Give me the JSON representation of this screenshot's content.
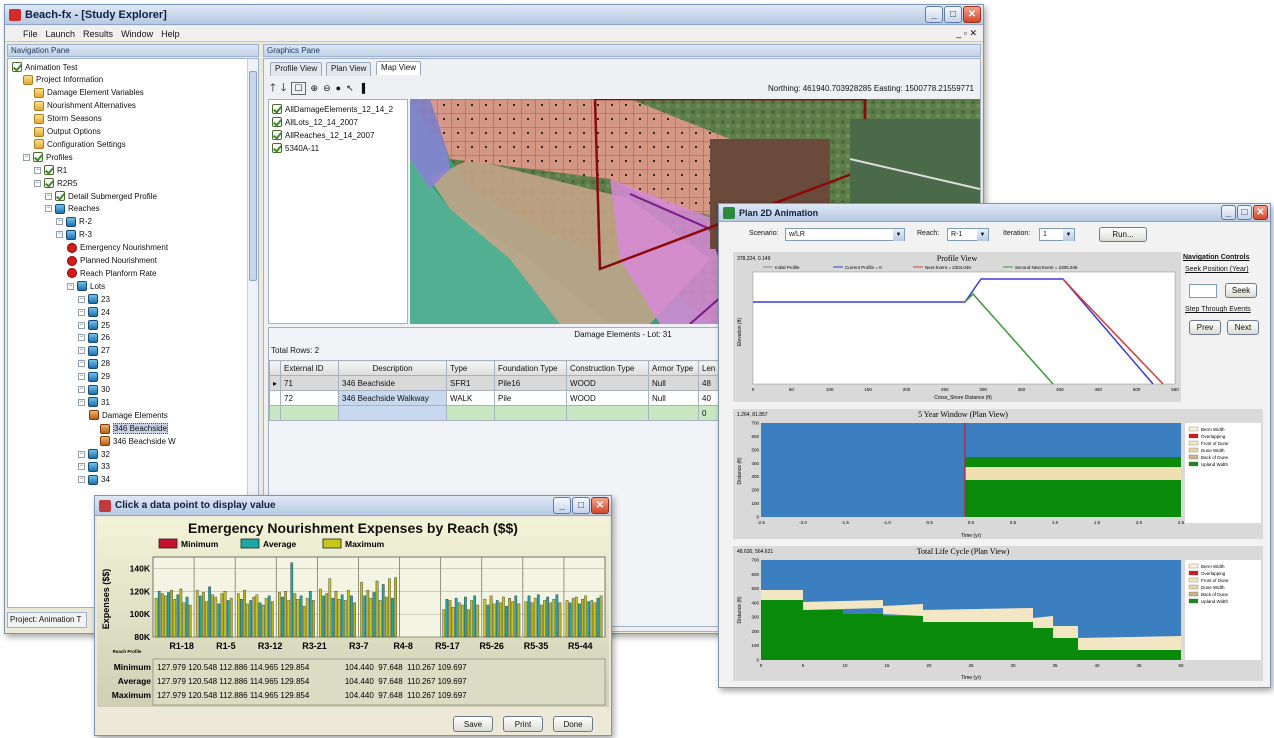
{
  "main_window": {
    "title": "Beach-fx - [Study Explorer]",
    "menu": [
      "File",
      "Launch",
      "Results",
      "Window",
      "Help"
    ],
    "nav_pane_title": "Navigation Pane",
    "graphics_pane_title": "Graphics Pane",
    "status": "Project: Animation T",
    "tree": [
      {
        "label": "Animation Test",
        "icon": "checkbox-icon",
        "level": 0
      },
      {
        "label": "Project Information",
        "icon": "folder-icon",
        "level": 1
      },
      {
        "label": "Damage Element Variables",
        "icon": "folder-icon",
        "level": 2
      },
      {
        "label": "Nourishment Alternatives",
        "icon": "folder-icon",
        "level": 2
      },
      {
        "label": "Storm Seasons",
        "icon": "folder-icon",
        "level": 2
      },
      {
        "label": "Output Options",
        "icon": "folder-icon",
        "level": 2
      },
      {
        "label": "Configuration Settings",
        "icon": "folder-icon",
        "level": 2
      },
      {
        "label": "Profiles",
        "icon": "checkbox-icon",
        "level": 1
      },
      {
        "label": "R1",
        "icon": "checkbox-icon",
        "level": 2
      },
      {
        "label": "R2R5",
        "icon": "checkbox-icon",
        "level": 2
      },
      {
        "label": "Detail Submerged Profile",
        "icon": "checkbox-icon",
        "level": 3
      },
      {
        "label": "Reaches",
        "icon": "lot-icon",
        "level": 3
      },
      {
        "label": "R-2",
        "icon": "lot-icon",
        "level": 4
      },
      {
        "label": "R-3",
        "icon": "lot-icon",
        "level": 4
      },
      {
        "label": "Emergency Nourishment",
        "icon": "red-icon",
        "level": 5
      },
      {
        "label": "Planned Nourishment",
        "icon": "red-icon",
        "level": 5
      },
      {
        "label": "Reach Planform Rate",
        "icon": "red-icon",
        "level": 5
      },
      {
        "label": "Lots",
        "icon": "lot-icon",
        "level": 5
      },
      {
        "label": "23",
        "icon": "lot-icon",
        "level": 6
      },
      {
        "label": "24",
        "icon": "lot-icon",
        "level": 6
      },
      {
        "label": "25",
        "icon": "lot-icon",
        "level": 6
      },
      {
        "label": "26",
        "icon": "lot-icon",
        "level": 6
      },
      {
        "label": "27",
        "icon": "lot-icon",
        "level": 6
      },
      {
        "label": "28",
        "icon": "lot-icon",
        "level": 6
      },
      {
        "label": "29",
        "icon": "lot-icon",
        "level": 6
      },
      {
        "label": "30",
        "icon": "lot-icon",
        "level": 6
      },
      {
        "label": "31",
        "icon": "lot-icon",
        "level": 6
      },
      {
        "label": "Damage Elements",
        "icon": "damage-icon",
        "level": 7
      },
      {
        "label": "346 Beachside",
        "icon": "damage-icon",
        "level": 8,
        "selected": true
      },
      {
        "label": "346 Beachside W",
        "icon": "damage-icon",
        "level": 8
      },
      {
        "label": "32",
        "icon": "lot-icon",
        "level": 6
      },
      {
        "label": "33",
        "icon": "lot-icon",
        "level": 6
      },
      {
        "label": "34",
        "icon": "lot-icon",
        "level": 6
      }
    ],
    "tabs": [
      "Profile View",
      "Plan View",
      "Map View"
    ],
    "active_tab": "Map View",
    "coords": "Northing: 461940.703928285  Easting: 1500778.21559771",
    "layers": [
      "AllDamageElements_12_14_2",
      "AllLots_12_14_2007",
      "AllReaches_12_14_2007",
      "5340A-11"
    ],
    "grid_title": "Damage Elements -  Lot: 31",
    "total_rows": "Total Rows: 2",
    "grid_columns": [
      "External ID",
      "Description",
      "Type",
      "Foundation Type",
      "Construction Type",
      "Armor Type",
      "Len"
    ],
    "grid_rows": [
      [
        "71",
        "346 Beachside",
        "SFR1",
        "Pile16",
        "WOOD",
        "Null",
        "48"
      ],
      [
        "72",
        "346 Beachside Walkway",
        "WALK",
        "Pile",
        "WOOD",
        "Null",
        "40"
      ],
      [
        "",
        "",
        "",
        "",
        "",
        "",
        "0"
      ]
    ]
  },
  "anim_window": {
    "title": "Plan 2D Animation",
    "scenario_label": "Scenario:",
    "scenario_value": "w/LR",
    "reach_label": "Reach:",
    "reach_value": "R-1",
    "iteration_label": "Iteration:",
    "iteration_value": "1",
    "run_label": "Run...",
    "nav_title": "Navigation Controls",
    "seek_label": "Seek Position (Year)",
    "seek_button": "Seek",
    "step_label": "Step Through Events",
    "prev_button": "Prev",
    "next_button": "Next",
    "profile_chart": {
      "title": "Profile View",
      "corner": "378,224, 0.149",
      "xlabel": "Cross_Shore Distance (ft)",
      "ylabel": "Elevation (ft)",
      "legend": [
        "Initial Profile",
        "Current Profile = 0",
        "Next Event = 2304.046",
        "Second Next Event = 2305.046"
      ],
      "colors": {
        "initial": "#8a8a8a",
        "current": "#3a3ad8",
        "next": "#d83a3a",
        "second": "#3a9a3a"
      },
      "xticks": [
        "0",
        "50",
        "100",
        "150",
        "200",
        "250",
        "300",
        "350",
        "400",
        "450",
        "500",
        "550"
      ],
      "yticks": [
        "-2",
        "-1",
        "0",
        "1",
        "2",
        "3",
        "4",
        "5",
        "6",
        "7"
      ]
    },
    "window_chart": {
      "title": "5 Year Window (Plan View)",
      "corner": "1.264, 81.857",
      "xlabel": "Time (yr)",
      "ylabel": "Distance (ft)",
      "xticks": [
        "-2.5",
        "-2.0",
        "-1.5",
        "-1.0",
        "-0.5",
        "0.0",
        "0.5",
        "1.0",
        "1.5",
        "2.0",
        "2.5"
      ],
      "yticks": [
        "0",
        "100",
        "200",
        "300",
        "400",
        "500",
        "600",
        "700"
      ],
      "legend": [
        "Berm Width",
        "Overlapping",
        "Front of Dune",
        "Dune Width",
        "Back of Dune",
        "Upland Width"
      ],
      "legend_colors": [
        "#f7f2d8",
        "#d11b1b",
        "#f0e6c0",
        "#e9d6a8",
        "#c9b48a",
        "#1b8a1b"
      ]
    },
    "lifecycle_chart": {
      "title": "Total Life Cycle (Plan View)",
      "corner": "48.630, 564.621",
      "xlabel": "Time (yr)",
      "ylabel": "Distance (ft)",
      "xticks": [
        "0",
        "5",
        "10",
        "15",
        "20",
        "25",
        "30",
        "35",
        "40",
        "45",
        "50"
      ],
      "yticks": [
        "0",
        "100",
        "200",
        "300",
        "400",
        "500",
        "600",
        "700"
      ],
      "legend": [
        "Berm Width",
        "Overlapping",
        "Front of Dune",
        "Dune Width",
        "Back of Dune",
        "Upland Width"
      ],
      "legend_colors": [
        "#f7f2d8",
        "#d11b1b",
        "#f0e6c0",
        "#e9d6a8",
        "#c9b48a",
        "#1b8a1b"
      ]
    }
  },
  "expense_window": {
    "title": "Click a data point to display value",
    "save_button": "Save",
    "print_button": "Print",
    "done_button": "Done",
    "row_labels": [
      "Minimum",
      "Average",
      "Maximum"
    ],
    "row_values": [
      "127.979 120.548 112.886 114.965 129.854                104.440  97.648  110.267 109.697",
      "127.979 120.548 112.886 114.965 129.854                104.440  97.648  110.267 109.697",
      "127.979 120.548 112.886 114.965 129.854                104.440  97.648  110.267 109.697"
    ],
    "corner_label": "Reach Profile"
  },
  "chart_data": {
    "type": "bar",
    "title": "Emergency Nourishment Expenses by Reach ($$)",
    "ylabel": "Expenses ($$)",
    "xlabel": "",
    "categories": [
      "R1-18",
      "R1-5",
      "R3-12",
      "R3-21",
      "R3-7",
      "R4-8",
      "R5-17",
      "R5-26",
      "R5-35",
      "R5-44"
    ],
    "series": [
      {
        "name": "Minimum",
        "color": "#c8102e"
      },
      {
        "name": "Average",
        "color": "#1fa7a7"
      },
      {
        "name": "Maximum",
        "color": "#c8c81a"
      }
    ],
    "yticks": [
      "80K",
      "100K",
      "120K",
      "140K"
    ],
    "ylim": [
      80,
      150
    ],
    "bar_values": [
      [
        114,
        120,
        118,
        116,
        119,
        121,
        113,
        117,
        122,
        110,
        115,
        108
      ],
      [
        121,
        116,
        119,
        111,
        124,
        117,
        115,
        109,
        118,
        120,
        112,
        114
      ],
      [
        118,
        113,
        121,
        109,
        112,
        115,
        117,
        110,
        108,
        114,
        116,
        111
      ],
      [
        119,
        115,
        120,
        112,
        145,
        118,
        113,
        116,
        107,
        114,
        120,
        112
      ],
      [
        122,
        116,
        118,
        131,
        114,
        120,
        113,
        117,
        112,
        121,
        116,
        110
      ],
      [
        128,
        116,
        121,
        114,
        119,
        129,
        112,
        126,
        115,
        131,
        114,
        132
      ],
      [
        0,
        0,
        0,
        0,
        0,
        0,
        0,
        0,
        0,
        0,
        0,
        0
      ],
      [
        104,
        113,
        112,
        106,
        114,
        110,
        108,
        115,
        104,
        112,
        116,
        108
      ],
      [
        113,
        108,
        116,
        109,
        112,
        110,
        115,
        107,
        114,
        111,
        116,
        109
      ],
      [
        111,
        116,
        110,
        114,
        117,
        108,
        112,
        115,
        110,
        113,
        117,
        110
      ],
      [
        112,
        110,
        114,
        115,
        109,
        113,
        116,
        111,
        112,
        110,
        114,
        116
      ]
    ],
    "grid": true,
    "legend": "top"
  }
}
